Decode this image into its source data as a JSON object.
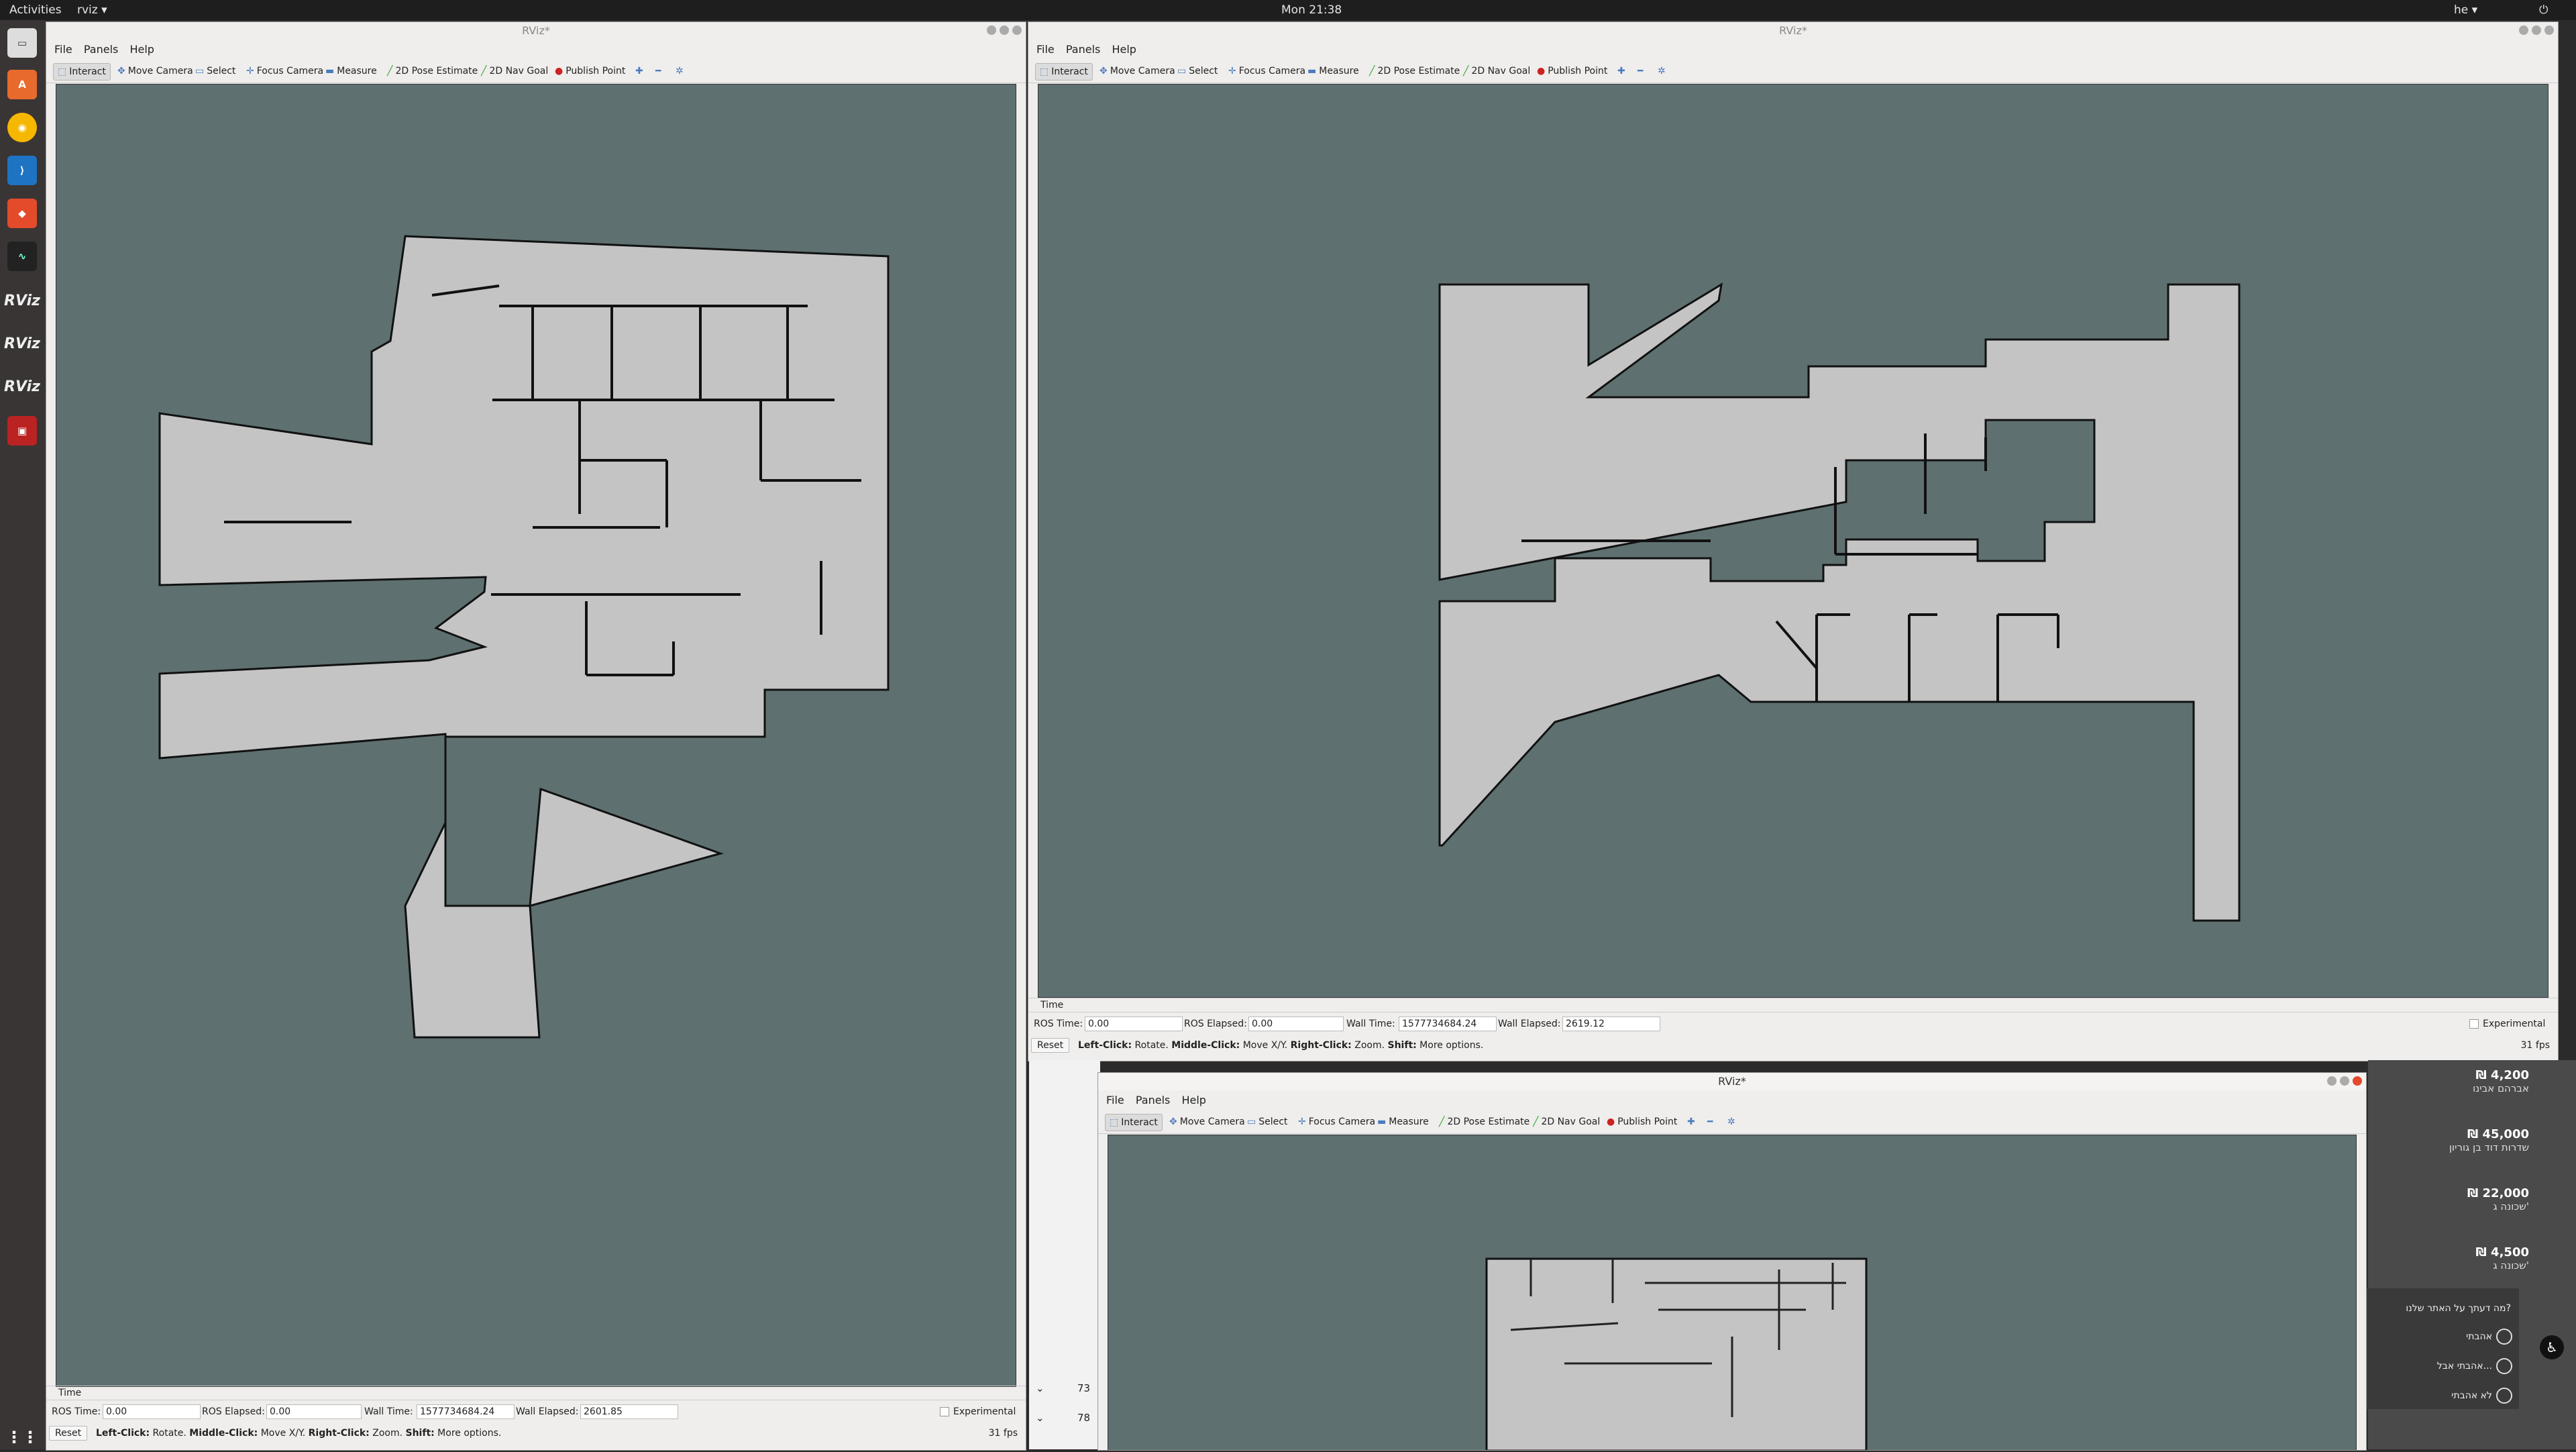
{
  "topbar": {
    "activities": "Activities",
    "app": "rviz ▾",
    "clock": "Mon 21:38",
    "lang": "he ▾"
  },
  "dock_apps": [
    "files-icon",
    "software-icon",
    "chrome-icon",
    "vscode-icon",
    "git-icon",
    "monitor-icon",
    "rviz",
    "rviz",
    "rviz",
    "terminal-icon"
  ],
  "dock_labels": {
    "rviz": "RViz"
  },
  "menu": {
    "file": "File",
    "panels": "Panels",
    "help": "Help"
  },
  "tools": {
    "interact": "Interact",
    "move_camera": "Move Camera",
    "select": "Select",
    "focus_camera": "Focus Camera",
    "measure": "Measure",
    "pose_estimate": "2D Pose Estimate",
    "nav_goal": "2D Nav Goal",
    "publish_point": "Publish Point"
  },
  "window_title": "RViz*",
  "time_panel": {
    "title": "Time",
    "ros_time_label": "ROS Time:",
    "ros_elapsed_label": "ROS Elapsed:",
    "wall_time_label": "Wall Time:",
    "wall_elapsed_label": "Wall Elapsed:",
    "experimental": "Experimental",
    "reset": "Reset",
    "hint_left": "Left-Click:",
    "hint_rotate": " Rotate. ",
    "hint_middle": "Middle-Click:",
    "hint_move": " Move X/Y. ",
    "hint_right": "Right-Click:",
    "hint_zoom": " Zoom. ",
    "hint_shift": "Shift:",
    "hint_more": " More options."
  },
  "left_window": {
    "ros_time": "0.00",
    "ros_elapsed": "0.00",
    "wall_time": "1577734684.24",
    "wall_elapsed": "2601.85",
    "fps": "31 fps"
  },
  "right_window": {
    "ros_time": "0.00",
    "ros_elapsed": "0.00",
    "wall_time": "1577734684.24",
    "wall_elapsed": "2619.12",
    "fps": "31 fps"
  },
  "listings": [
    {
      "price": "₪ 4,200",
      "sub": "אברהם אבינו"
    },
    {
      "price": "₪ 45,000",
      "sub": "שדרות דוד בן גוריון"
    },
    {
      "price": "₪ 22,000",
      "sub": "שכונה ג'"
    },
    {
      "price": "₪ 4,500",
      "sub": "שכונה ג'"
    }
  ],
  "survey": {
    "question": "מה דעתך על האתר שלנו?",
    "opt1": "אהבתי",
    "opt2": "אהבתי אבל...",
    "opt3": "לא אהבתי"
  },
  "mid_numbers": [
    "73",
    "78"
  ]
}
